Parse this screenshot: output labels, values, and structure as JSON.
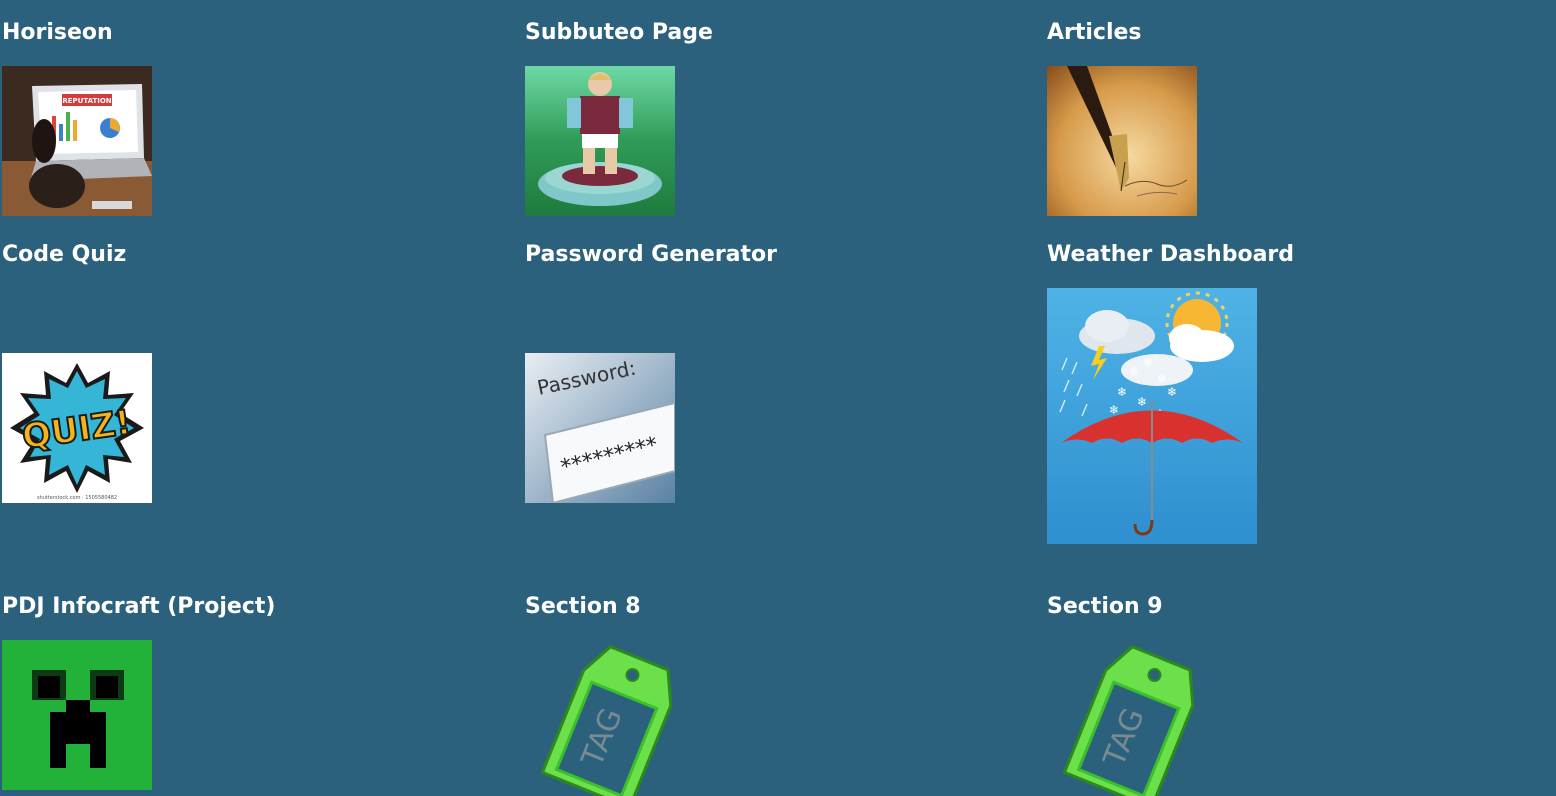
{
  "page": {
    "background": "#2c617e",
    "text_color": "#ffffff"
  },
  "sections": [
    {
      "title": "Horiseon",
      "image": "laptop-reputation-photo",
      "image_text": "REPUTATION"
    },
    {
      "title": "Subbuteo Page",
      "image": "subbuteo-figure-photo"
    },
    {
      "title": "Articles",
      "image": "fountain-pen-photo"
    },
    {
      "title": "Code Quiz",
      "image": "quiz-comic-image",
      "image_text": "QUIZ!",
      "image_caption": "shutterstock.com · 1505580482"
    },
    {
      "title": "Password Generator",
      "image": "password-field-image",
      "image_text": "Password:",
      "image_value": "*********"
    },
    {
      "title": "Weather Dashboard",
      "image": "weather-umbrella-image"
    },
    {
      "title": "PDJ Infocraft (Project)",
      "image": "creeper-face-image"
    },
    {
      "title": "Section 8",
      "image": "tag-icon",
      "image_text": "TAG"
    },
    {
      "title": "Section 9",
      "image": "tag-icon",
      "image_text": "TAG"
    }
  ]
}
